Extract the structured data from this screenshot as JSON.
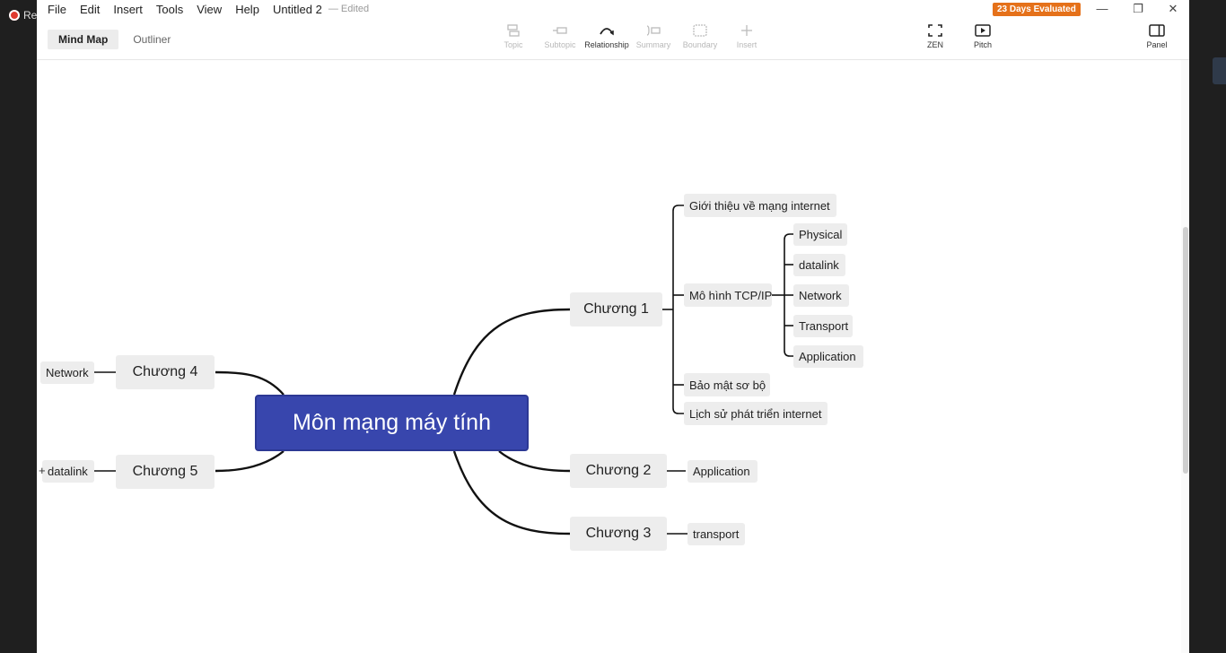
{
  "recorder": {
    "label": "Re"
  },
  "menu": [
    "File",
    "Edit",
    "Insert",
    "Tools",
    "View",
    "Help"
  ],
  "document": {
    "title": "Untitled 2",
    "status": "— Edited"
  },
  "view_tabs": [
    "Mind Map",
    "Outliner"
  ],
  "toolbar": {
    "items": [
      {
        "label": "Topic",
        "icon": "topic-icon"
      },
      {
        "label": "Subtopic",
        "icon": "subtopic-icon"
      },
      {
        "label": "Relationship",
        "icon": "relationship-icon"
      },
      {
        "label": "Summary",
        "icon": "summary-icon"
      },
      {
        "label": "Boundary",
        "icon": "boundary-icon"
      },
      {
        "label": "Insert",
        "icon": "plus-icon"
      }
    ],
    "zen": "ZEN",
    "pitch": "Pitch",
    "panel": "Panel"
  },
  "evaluation_badge": "23 Days Evaluated",
  "window_controls": {
    "minimize": "—",
    "restore": "❐",
    "close": "✕"
  },
  "mindmap": {
    "central": "Môn mạng máy tính",
    "chuong1": {
      "label": "Chương 1",
      "children": [
        {
          "label": "Giới thiệu về mạng internet"
        },
        {
          "label": "Mô hình TCP/IP",
          "children": [
            "Physical",
            "datalink",
            "Network",
            "Transport",
            "Application"
          ]
        },
        {
          "label": "Bảo mật sơ bộ"
        },
        {
          "label": "Lịch sử phát triển internet"
        }
      ]
    },
    "chuong2": {
      "label": "Chương 2",
      "child": "Application"
    },
    "chuong3": {
      "label": "Chương 3",
      "child": "transport"
    },
    "chuong4": {
      "label": "Chương 4",
      "child": "Network"
    },
    "chuong5": {
      "label": "Chương 5",
      "child": "datalink",
      "collapse_marker": "+"
    }
  },
  "colors": {
    "central_fill": "#3846ad",
    "node_fill": "#ededed",
    "badge": "#e5711a",
    "line": "#111111"
  }
}
